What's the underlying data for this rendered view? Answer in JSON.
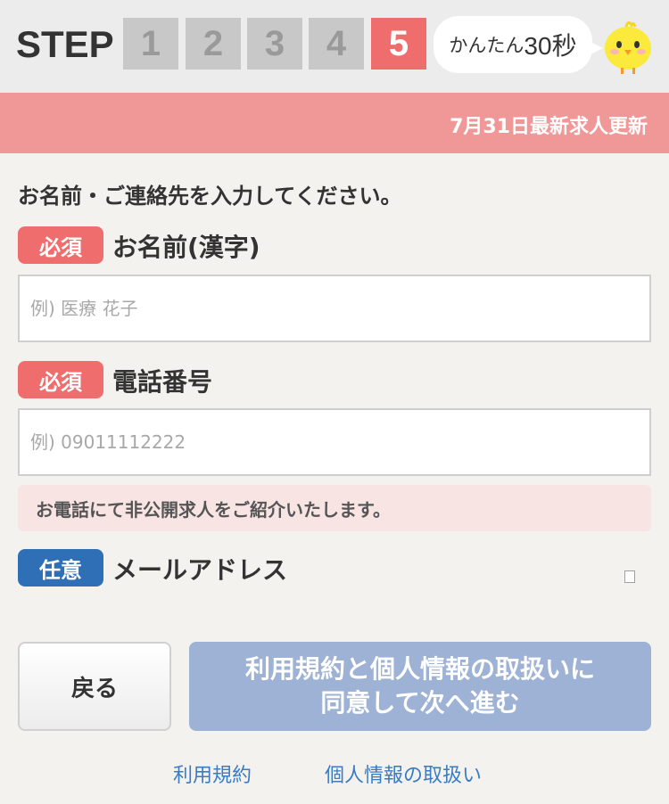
{
  "header": {
    "step_label": "STEP",
    "steps": [
      "1",
      "2",
      "3",
      "4",
      "5"
    ],
    "active_step": "5",
    "bubble_prefix": "かんたん",
    "bubble_time": "30秒"
  },
  "banner": {
    "update_text": "7月31日最新求人更新"
  },
  "form": {
    "intro": "お名前・ご連絡先を入力してください。",
    "required_badge": "必須",
    "optional_badge": "任意",
    "name_label": "お名前(漢字)",
    "name_placeholder": "例) 医療 花子",
    "phone_label": "電話番号",
    "phone_placeholder": "例) 09011112222",
    "phone_note": "お電話にて非公開求人をご紹介いたします。",
    "email_label": "メールアドレス"
  },
  "buttons": {
    "back": "戻る",
    "next_line1": "利用規約と個人情報の取扱いに",
    "next_line2": "同意して次へ進む"
  },
  "links": {
    "terms": "利用規約",
    "privacy": "個人情報の取扱い"
  },
  "colors": {
    "accent_red": "#ef6d6d",
    "banner_pink": "#f09798",
    "optional_blue": "#2f6fb6",
    "next_button": "#9db2d4"
  }
}
